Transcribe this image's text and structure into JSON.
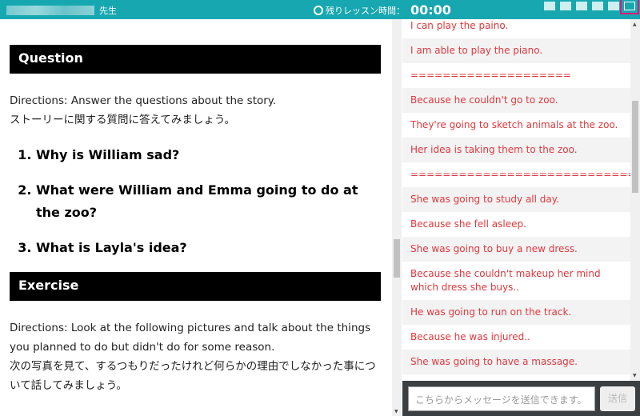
{
  "header": {
    "teacher_suffix": "先生",
    "timer_label": "残りレッスン時間：",
    "timer_value": "00:00",
    "brand_color": "#17a7b0"
  },
  "lesson": {
    "question_title": "Question",
    "question_directions_en": "Directions: Answer the questions about the story.",
    "question_directions_ja": "ストーリーに関する質問に答えてみましょう。",
    "questions": [
      "Why is William sad?",
      "What were William and Emma going to do at the zoo?",
      "What is Layla's idea?"
    ],
    "exercise_title": "Exercise",
    "exercise_directions_en": "Directions: Look at the following pictures and talk about the things you planned to do but didn't do for some reason.",
    "exercise_directions_ja": "次の写真を見て、するつもりだったけれど何らかの理由でしなかった事について話してみましょう。"
  },
  "chat": {
    "messages": [
      "I can play the paino.",
      "I am able to play the piano.",
      "====================",
      "Because he couldn't go to zoo.",
      "They're going to sketch animals at the zoo.",
      "Her idea is taking them to the zoo.",
      "=================================",
      "She was going to study all day.",
      "Because she fell asleep.",
      "She was going to buy a new dress.",
      "Because she couldn't makeup her mind which dress she buys..",
      "He was going to run on the track.",
      "Because he was injured..",
      "She was going to have a massage."
    ],
    "message_color": "#e0383d",
    "input_placeholder": "こちらからメッセージを送信できます。",
    "send_label": "送信"
  }
}
